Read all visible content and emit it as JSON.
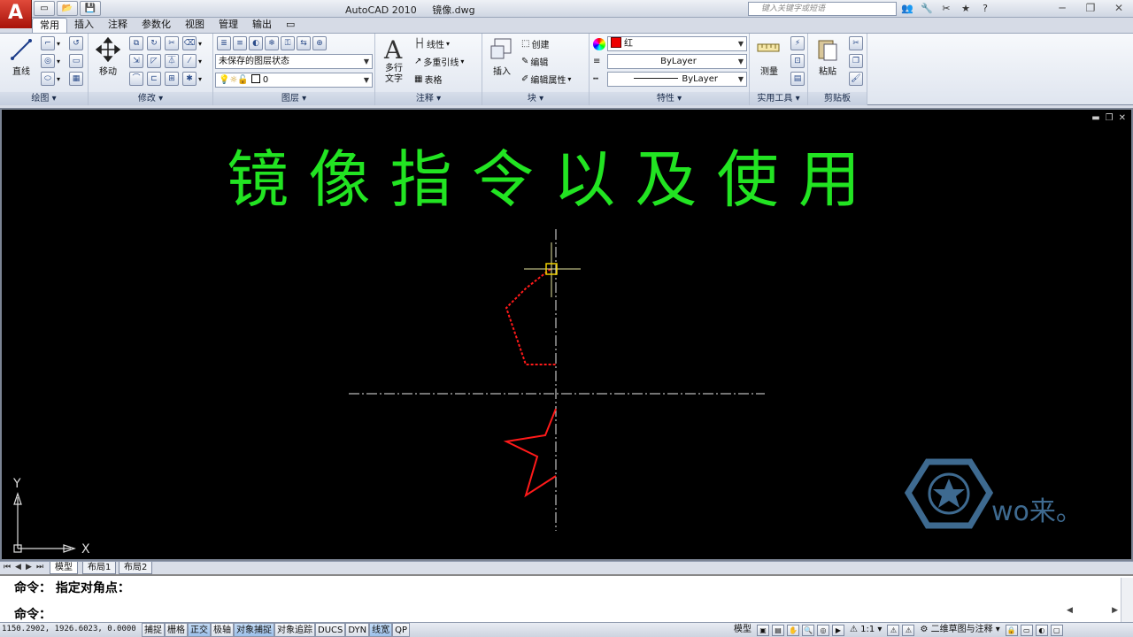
{
  "app": {
    "logo": "A",
    "window_title": "AutoCAD 2010     镜像.dwg",
    "search_placeholder": "键入关键字或短语"
  },
  "qat": [
    "▭",
    "📂",
    "💾"
  ],
  "infocenter": [
    "👥",
    "🔧",
    "✂",
    "★",
    "?"
  ],
  "window_controls": [
    "─",
    "❐",
    "✕"
  ],
  "ribbon_tabs": [
    "常用",
    "插入",
    "注释",
    "参数化",
    "视图",
    "管理",
    "输出",
    "▭"
  ],
  "ribbon": {
    "draw": {
      "title": "绘图 ▾",
      "line_label": "直线"
    },
    "modify": {
      "title": "修改 ▾",
      "move_label": "移动"
    },
    "layers": {
      "title": "图层 ▾",
      "layer_state": "未保存的图层状态",
      "current_layer": "0"
    },
    "annotation": {
      "title": "注释 ▾",
      "mtext_label": "多行\n文字",
      "linear": "线性",
      "mleader": "多重引线",
      "table": "表格"
    },
    "block": {
      "title": "块 ▾",
      "insert_label": "插入",
      "create": "创建",
      "edit": "编辑",
      "edit_attr": "编辑属性"
    },
    "properties": {
      "title": "特性 ▾",
      "color": "红",
      "linetype": "ByLayer",
      "lineweight": "ByLayer"
    },
    "utilities": {
      "title": "实用工具 ▾",
      "measure_label": "测量"
    },
    "clipboard": {
      "title": "剪贴板",
      "paste_label": "粘贴"
    }
  },
  "canvas": {
    "heading": "镜 像 指 令 以 及 使 用",
    "heading_color": "#22e422",
    "object_color": "#ff1a1a",
    "watermark": "wo来。",
    "axis_x": "X",
    "axis_y": "Y"
  },
  "layout_tabs": [
    "模型",
    "布局1",
    "布局2"
  ],
  "command": {
    "line1": "命令： 指定对角点：",
    "line2": "命令："
  },
  "status": {
    "coords": "1150.2902,  1926.6023,  0.0000",
    "toggles": [
      {
        "label": "捕捉",
        "on": false
      },
      {
        "label": "栅格",
        "on": false
      },
      {
        "label": "正交",
        "on": true
      },
      {
        "label": "极轴",
        "on": false
      },
      {
        "label": "对象捕捉",
        "on": true
      },
      {
        "label": "对象追踪",
        "on": false
      },
      {
        "label": "DUCS",
        "on": false
      },
      {
        "label": "DYN",
        "on": false
      },
      {
        "label": "线宽",
        "on": true
      },
      {
        "label": "QP",
        "on": false
      }
    ],
    "model_label": "模型",
    "scale": "1:1 ▾",
    "workspace": "二维草图与注释 ▾"
  }
}
